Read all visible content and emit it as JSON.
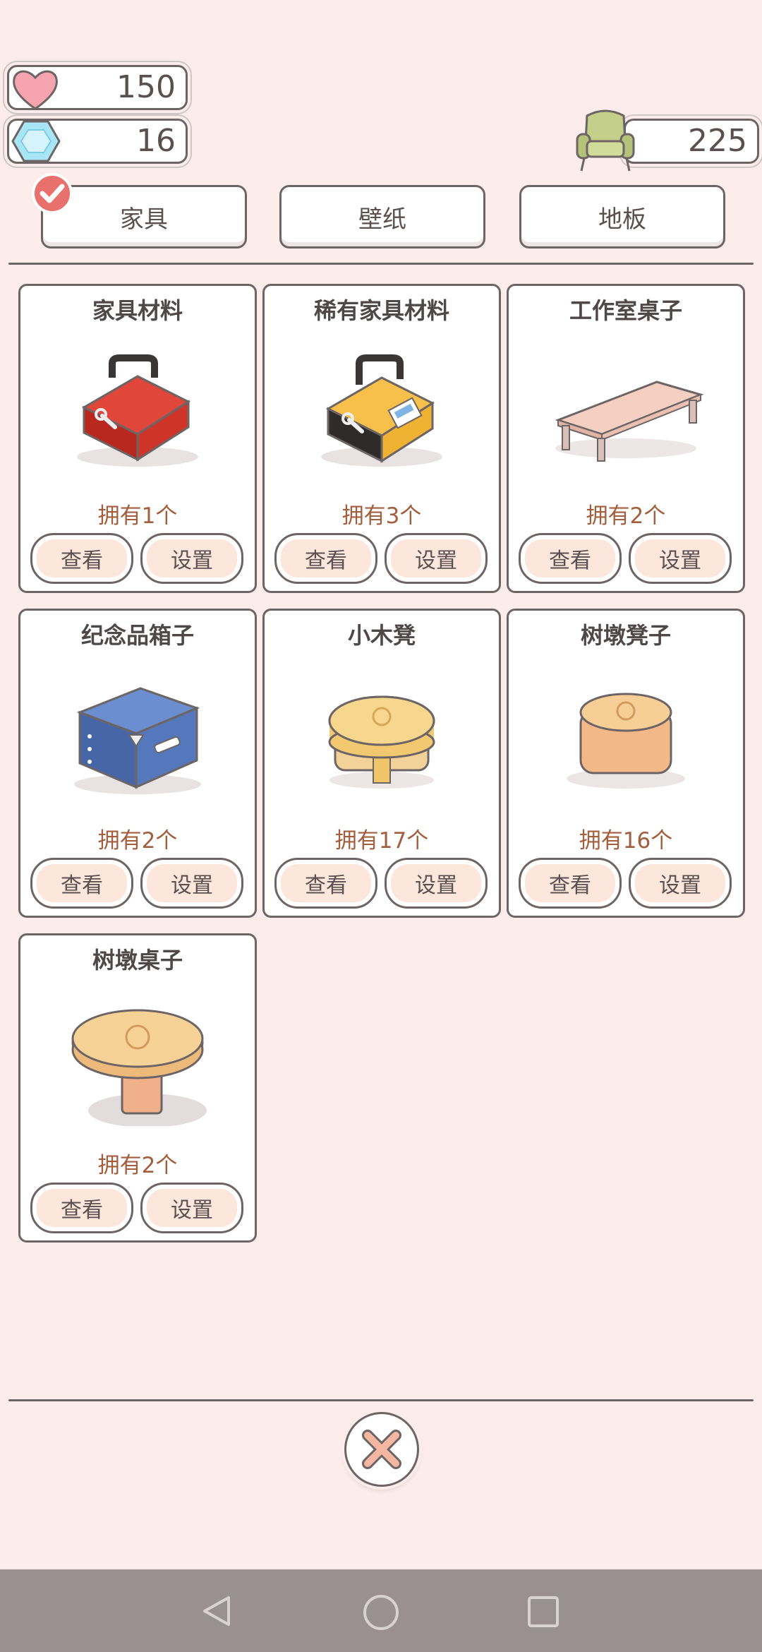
{
  "currencies": {
    "hearts": "150",
    "gems": "16",
    "furniture_points": "225"
  },
  "tabs": [
    {
      "label": "家具",
      "selected": true
    },
    {
      "label": "壁纸",
      "selected": false
    },
    {
      "label": "地板",
      "selected": false
    }
  ],
  "items": [
    {
      "title": "家具材料",
      "owned": "拥有1个",
      "view": "查看",
      "set": "设置",
      "icon": "red-toolbox-icon"
    },
    {
      "title": "稀有家具材料",
      "owned": "拥有3个",
      "view": "查看",
      "set": "设置",
      "icon": "yellow-toolbox-icon"
    },
    {
      "title": "工作室桌子",
      "owned": "拥有2个",
      "view": "查看",
      "set": "设置",
      "icon": "low-table-icon"
    },
    {
      "title": "纪念品箱子",
      "owned": "拥有2个",
      "view": "查看",
      "set": "设置",
      "icon": "blue-chest-icon"
    },
    {
      "title": "小木凳",
      "owned": "拥有17个",
      "view": "查看",
      "set": "设置",
      "icon": "wood-stool-icon"
    },
    {
      "title": "树墩凳子",
      "owned": "拥有16个",
      "view": "查看",
      "set": "设置",
      "icon": "stump-stool-icon"
    },
    {
      "title": "树墩桌子",
      "owned": "拥有2个",
      "view": "查看",
      "set": "设置",
      "icon": "stump-table-icon"
    }
  ],
  "colors": {
    "background": "#fcecec",
    "owned_text": "#a35e3e",
    "button_fill": "#fde6dc",
    "check": "#e8716d"
  }
}
